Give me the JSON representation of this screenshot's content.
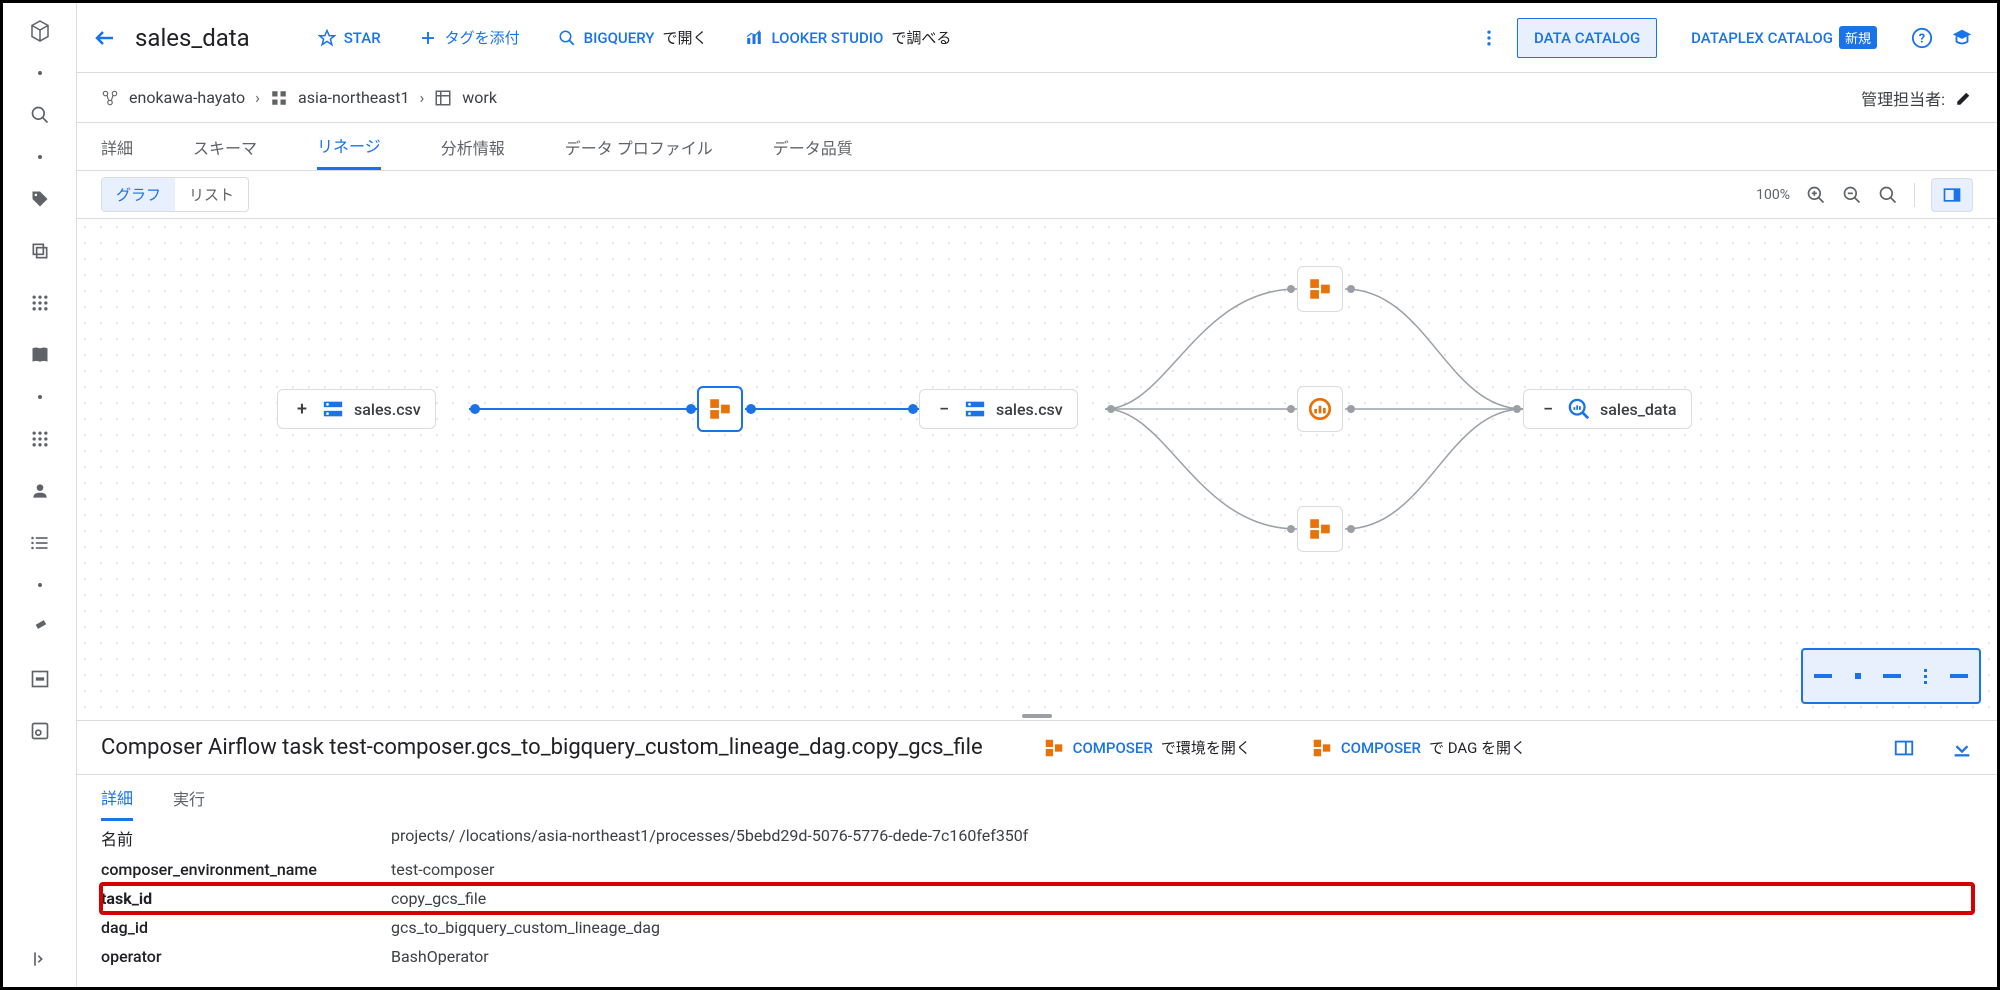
{
  "header": {
    "title": "sales_data",
    "star": "STAR",
    "tag_attach": "タグを添付",
    "bigquery_open": "BIGQUERY",
    "bigquery_open_jp": "で開く",
    "looker": "LOOKER STUDIO",
    "looker_jp": "で調べる",
    "catalog1": "DATA CATALOG",
    "catalog2": "DATAPLEX CATALOG",
    "new_badge": "新規"
  },
  "breadcrumb": {
    "items": [
      "enokawa-hayato",
      "asia-northeast1",
      "work"
    ],
    "admin_label": "管理担当者:"
  },
  "tabs": [
    "詳細",
    "スキーマ",
    "リネージ",
    "分析情報",
    "データ プロファイル",
    "データ品質"
  ],
  "toolbar": {
    "graph": "グラフ",
    "list": "リスト",
    "zoom": "100%"
  },
  "lineage": {
    "node1": "sales.csv",
    "node2": "sales.csv",
    "node3": "sales_data"
  },
  "details": {
    "title": "Composer Airflow task test-composer.gcs_to_bigquery_custom_lineage_dag.copy_gcs_file",
    "link1": "COMPOSER",
    "link1_jp": "で環境を開く",
    "link2": "COMPOSER",
    "link2_jp": "で DAG を開く",
    "tabs": [
      "詳細",
      "実行"
    ],
    "props": [
      {
        "k": "名前",
        "v": "projects/                    /locations/asia-northeast1/processes/5bebd29d-5076-5776-dede-7c160fef350f"
      },
      {
        "k": "composer_environment_name",
        "v": "test-composer"
      },
      {
        "k": "task_id",
        "v": "copy_gcs_file"
      },
      {
        "k": "dag_id",
        "v": "gcs_to_bigquery_custom_lineage_dag"
      },
      {
        "k": "operator",
        "v": "BashOperator"
      }
    ]
  }
}
